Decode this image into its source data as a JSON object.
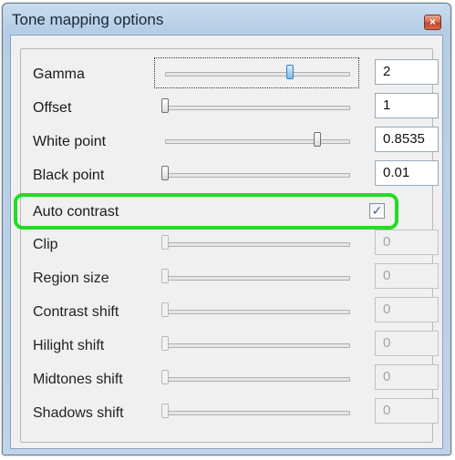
{
  "window": {
    "title": "Tone mapping options",
    "close_glyph": "×"
  },
  "controls": [
    {
      "label": "Gamma",
      "value": "2",
      "slider_fraction": 0.7,
      "enabled": true,
      "active": true
    },
    {
      "label": "Offset",
      "value": "1",
      "slider_fraction": 0.0,
      "enabled": true
    },
    {
      "label": "White point",
      "value": "0.8535",
      "slider_fraction": 0.85,
      "enabled": true
    },
    {
      "label": "Black point",
      "value": "0.01",
      "slider_fraction": 0.0,
      "enabled": true
    },
    {
      "label": "Auto contrast",
      "type": "checkbox",
      "checked": true,
      "check_glyph": "✓"
    },
    {
      "label": "Clip",
      "value": "0",
      "slider_fraction": 0.0,
      "enabled": false
    },
    {
      "label": "Region size",
      "value": "0",
      "slider_fraction": 0.0,
      "enabled": false
    },
    {
      "label": "Contrast shift",
      "value": "0",
      "slider_fraction": 0.0,
      "enabled": false
    },
    {
      "label": "Hilight shift",
      "value": "0",
      "slider_fraction": 0.0,
      "enabled": false
    },
    {
      "label": "Midtones shift",
      "value": "0",
      "slider_fraction": 0.0,
      "enabled": false
    },
    {
      "label": "Shadows shift",
      "value": "0",
      "slider_fraction": 0.0,
      "enabled": false
    }
  ],
  "highlight_color": "#22dd22"
}
